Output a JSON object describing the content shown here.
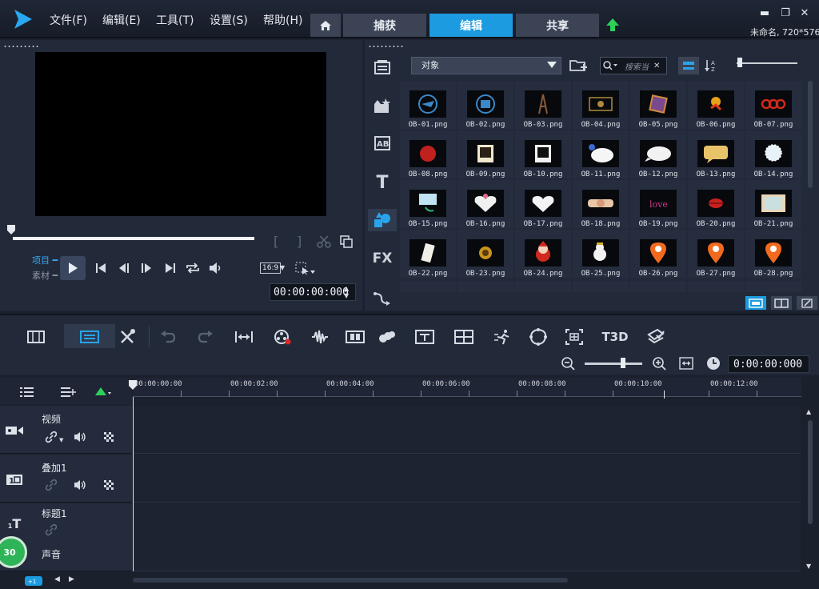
{
  "menu": {
    "file": "文件(F)",
    "edit": "编辑(E)",
    "tools": "工具(T)",
    "settings": "设置(S)",
    "help": "帮助(H)"
  },
  "tabs": {
    "capture": "捕获",
    "edit": "编辑",
    "share": "共享"
  },
  "project_info": "未命名, 720*576",
  "player": {
    "mode_project": "项目",
    "mode_clip": "素材",
    "ratio": "16:9",
    "timecode": "00:00:00:000"
  },
  "library": {
    "folder": "对象",
    "search_placeholder": "搜索当",
    "items": [
      "OB-01.png",
      "OB-02.png",
      "OB-03.png",
      "OB-04.png",
      "OB-05.png",
      "OB-06.png",
      "OB-07.png",
      "OB-08.png",
      "OB-09.png",
      "OB-10.png",
      "OB-11.png",
      "OB-12.png",
      "OB-13.png",
      "OB-14.png",
      "OB-15.png",
      "OB-16.png",
      "OB-17.png",
      "OB-18.png",
      "OB-19.png",
      "OB-20.png",
      "OB-21.png",
      "OB-22.png",
      "OB-23.png",
      "OB-24.png",
      "OB-25.png",
      "OB-26.png",
      "OB-27.png",
      "OB-28.png"
    ],
    "sidebar_labels": {
      "title": "T",
      "fx": "FX"
    }
  },
  "toolbar": {
    "timecode": "0:00:00:000",
    "text3d": "T3D"
  },
  "timeline": {
    "ruler": [
      "00:00:00:00",
      "00:00:02:00",
      "00:00:04:00",
      "00:00:06:00",
      "00:00:08:00",
      "00:00:10:00",
      "00:00:12:00"
    ],
    "tracks": [
      {
        "name": "视频"
      },
      {
        "name": "叠加1"
      },
      {
        "name": "标题1"
      },
      {
        "name": "声音"
      }
    ],
    "badge": "30"
  },
  "colors": {
    "accent": "#1c9be0",
    "play_green": "#2fd05a"
  }
}
